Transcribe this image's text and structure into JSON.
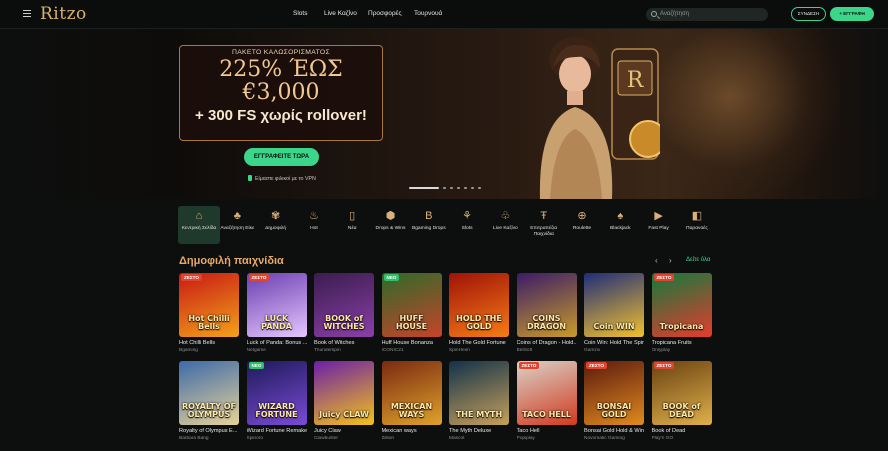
{
  "header": {
    "logo": "Ritzo",
    "nav": [
      "Slots",
      "Live Καζίνο",
      "Προσφορές",
      "Τουρνουά"
    ],
    "search_placeholder": "Αναζήτηση",
    "login_label": "ΣΥΝΔΕΣΗ",
    "register_label": "ΕΓΓΡΑΦΗ"
  },
  "hero": {
    "offer_line1": "ΠΑΚΕΤΟ ΚΑΛΩΣΟΡΙΣΜΑΤΟΣ",
    "offer_line2": "225% ΈΩΣ",
    "offer_line3": "€3,000",
    "offer_line4": "+ 300 FS χωρίς rollover!",
    "cta_label": "ΕΓΓΡΑΦΕΙΤΕ ΤΩΡΑ",
    "vpn_note": "Είμαστε φιλικοί με το VPN",
    "slides_total": 7,
    "slide_active": 1
  },
  "categories": [
    {
      "label": "Κεντρική Σελίδα",
      "icon": "home-icon",
      "glyph": "⌂"
    },
    {
      "label": "Αναζήτηση Είκε",
      "icon": "clover-icon",
      "glyph": "♣"
    },
    {
      "label": "Δημοφιλή",
      "icon": "laurel-icon",
      "glyph": "✾"
    },
    {
      "label": "Hot",
      "icon": "flame-icon",
      "glyph": "♨"
    },
    {
      "label": "Νέα",
      "icon": "phone-icon",
      "glyph": "▯"
    },
    {
      "label": "Drops & Wins",
      "icon": "drops-icon",
      "glyph": "⬢"
    },
    {
      "label": "Bgaming Drops",
      "icon": "b-badge-icon",
      "glyph": "B"
    },
    {
      "label": "Slots",
      "icon": "cherry-icon",
      "glyph": "⚘"
    },
    {
      "label": "Live Καζίνο",
      "icon": "club-icon",
      "glyph": "♧"
    },
    {
      "label": "Επιτραπέζια Παιχνίδια",
      "icon": "cocktail-icon",
      "glyph": "Ŧ"
    },
    {
      "label": "Roulette",
      "icon": "roulette-icon",
      "glyph": "⊕"
    },
    {
      "label": "Blackjack",
      "icon": "cards-icon",
      "glyph": "♠"
    },
    {
      "label": "Fast Play",
      "icon": "play-icon",
      "glyph": "▶"
    },
    {
      "label": "Παρανοές",
      "icon": "chip-icon",
      "glyph": "◧"
    }
  ],
  "section": {
    "title": "Δημοφιλή παιχνίδια",
    "see_all": "Δείτε όλα"
  },
  "colors": {
    "accent_green": "#3bd68a",
    "gold": "#d9b36a",
    "section_title": "#e6a96a"
  },
  "games": [
    {
      "name": "Hot Chilli Bells",
      "provider": "Bgaming",
      "badge": "ΖΕΣΤΟ",
      "badge_type": "hot",
      "art": "Hot Chilli Bells",
      "c1": "#c81a14",
      "c2": "#f3a11a"
    },
    {
      "name": "Luck of Panda: Bonus ...",
      "provider": "Netgame",
      "badge": "ΖΕΣΤΟ",
      "badge_type": "hot",
      "art": "LUCK PANDA",
      "c1": "#6a3fb0",
      "c2": "#e6c5ff"
    },
    {
      "name": "Book of Witches",
      "provider": "Thunderspin",
      "badge": "",
      "badge_type": "",
      "art": "BOOK of WITCHES",
      "c1": "#3a1d4e",
      "c2": "#8a3fa8"
    },
    {
      "name": "Huff House Bonanza",
      "provider": "ICONIC21",
      "badge": "ΝΕΟ",
      "badge_type": "new",
      "art": "HUFF HOUSE",
      "c1": "#2e6b2a",
      "c2": "#c7432a"
    },
    {
      "name": "Hold The Gold Fortune",
      "provider": "SpinHeim",
      "badge": "",
      "badge_type": "",
      "art": "HOLD THE GOLD",
      "c1": "#a01208",
      "c2": "#f57c16"
    },
    {
      "name": "Coins of Dragon - Hold...",
      "provider": "BetSoft",
      "badge": "",
      "badge_type": "",
      "art": "COINS DRAGON",
      "c1": "#3a1c68",
      "c2": "#c99a2a"
    },
    {
      "name": "Coin Win: Hold The Spin",
      "provider": "Gamzix",
      "badge": "",
      "badge_type": "",
      "art": "Coin WIN",
      "c1": "#1f2d7a",
      "c2": "#f2c12e"
    },
    {
      "name": "Tropicana Fruits",
      "provider": "Onlyplay",
      "badge": "ΖΕΣΤΟ",
      "badge_type": "hot",
      "art": "Tropicana",
      "c1": "#127a3c",
      "c2": "#e63b2e"
    },
    {
      "name": "Royalty of Olympus E...",
      "provider": "Barbara Bang",
      "badge": "",
      "badge_type": "",
      "art": "ROYALTY OF OLYMPUS",
      "c1": "#3d6aa8",
      "c2": "#e6d29a"
    },
    {
      "name": "Wizard Fortune Remake",
      "provider": "Spinoro",
      "badge": "ΝΕΟ",
      "badge_type": "new",
      "art": "WIZARD FORTUNE",
      "c1": "#1e1a5a",
      "c2": "#7a4bd6"
    },
    {
      "name": "Juicy Claw",
      "provider": "Clawbuster",
      "badge": "",
      "badge_type": "",
      "art": "Juicy CLAW",
      "c1": "#6a1fa8",
      "c2": "#f5c21a"
    },
    {
      "name": "Mexican ways",
      "provider": "Zillion",
      "badge": "",
      "badge_type": "",
      "art": "MEXICAN WAYS",
      "c1": "#7a2a12",
      "c2": "#e0a22a"
    },
    {
      "name": "The Myth Deluxe",
      "provider": "Mascot",
      "badge": "",
      "badge_type": "",
      "art": "THE MYTH",
      "c1": "#12324a",
      "c2": "#c7a05a"
    },
    {
      "name": "Taco Hell",
      "provider": "Popiplay",
      "badge": "ΖΕΣΤΟ",
      "badge_type": "hot",
      "art": "TACO HELL",
      "c1": "#d9d2c8",
      "c2": "#d13a20"
    },
    {
      "name": "Bonsai Gold Hold & Win",
      "provider": "Novomatic Gaming",
      "badge": "ΖΕΣΤΟ",
      "badge_type": "hot",
      "art": "BONSAI GOLD",
      "c1": "#5a1a0e",
      "c2": "#e08a1e"
    },
    {
      "name": "Book of Dead",
      "provider": "Play'n GO",
      "badge": "ΖΕΣΤΟ",
      "badge_type": "hot",
      "art": "BOOK of DEAD",
      "c1": "#6a4212",
      "c2": "#e0b04a"
    }
  ]
}
